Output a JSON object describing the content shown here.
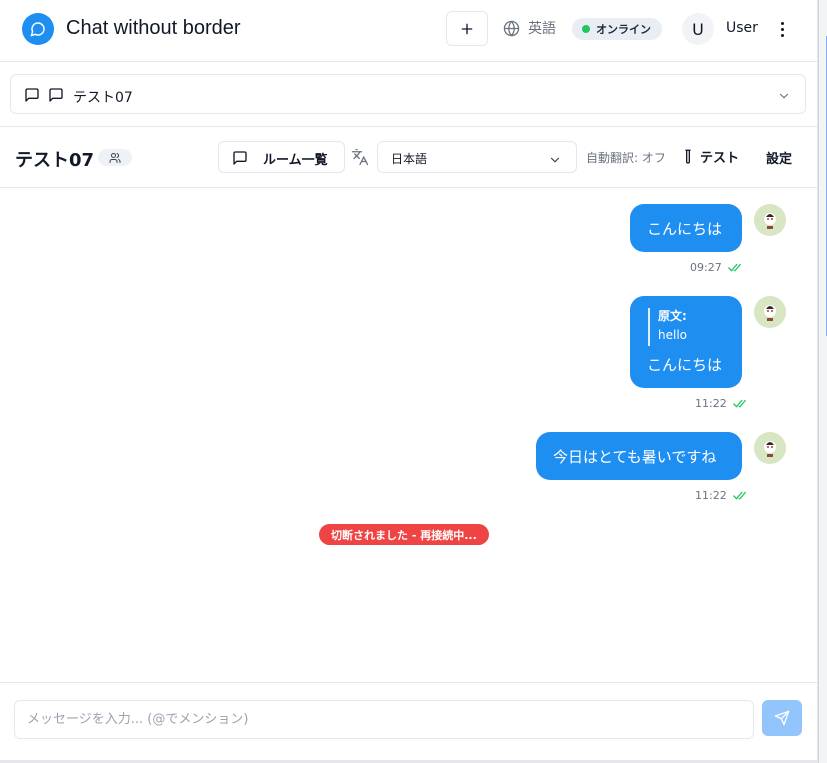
{
  "header": {
    "app_title": "Chat without border",
    "language": "英語",
    "status": "オンライン",
    "avatar_initial": "U",
    "user_name": "User"
  },
  "room_selector": {
    "selected": "テスト07"
  },
  "room_bar": {
    "room_title": "テスト07",
    "room_list_label": "ルーム一覧",
    "language_select": "日本語",
    "auto_translate": "自動翻訳: オフ",
    "test_label": "テスト",
    "settings_label": "設定"
  },
  "messages": [
    {
      "text": "こんにちは",
      "time": "09:27"
    },
    {
      "quote_label": "原文:",
      "quote_text": "hello",
      "text": "こんにちは",
      "time": "11:22"
    },
    {
      "text": "今日はとても暑いですね",
      "time": "11:22"
    }
  ],
  "connection_status": "切断されました - 再接続中...",
  "composer": {
    "placeholder": "メッセージを入力... (@でメンション)"
  },
  "colors": {
    "accent": "#1f8ef1",
    "online": "#22c55e",
    "error": "#ef4444",
    "send_disabled": "#93c5fd"
  }
}
